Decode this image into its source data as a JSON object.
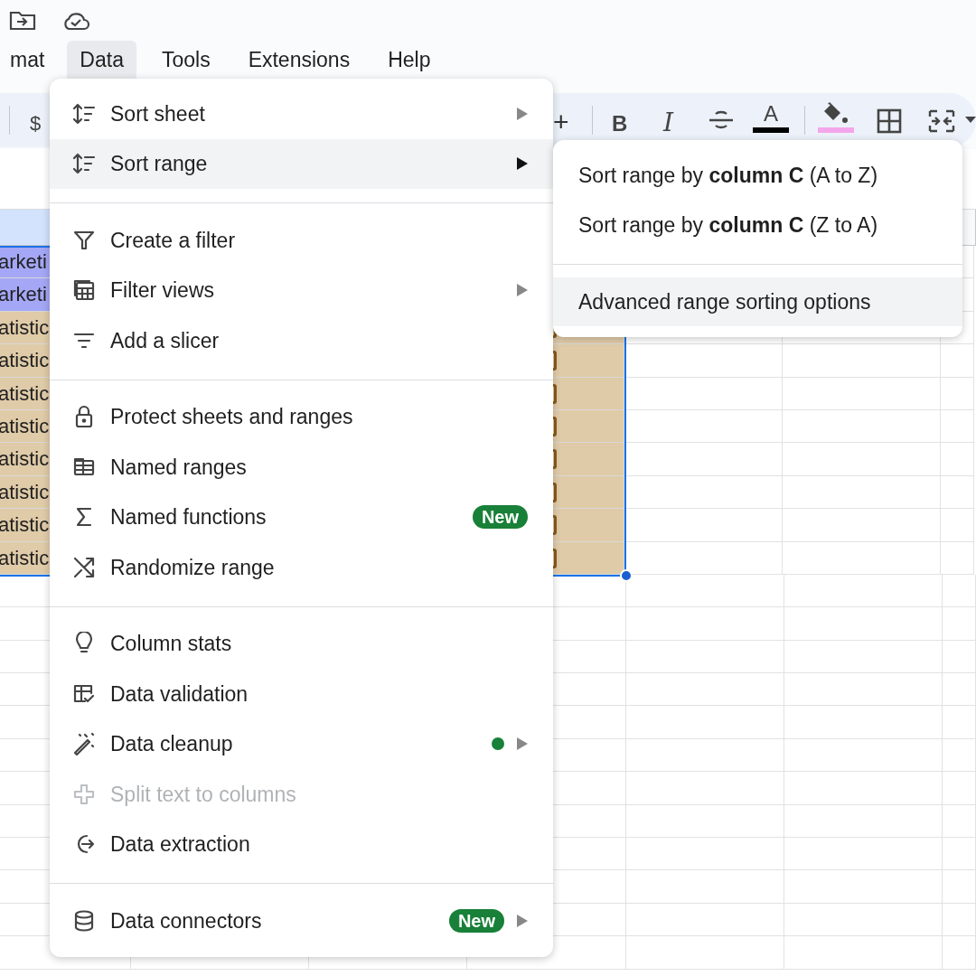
{
  "menu_bar": [
    {
      "label": "mat",
      "selected": false
    },
    {
      "label": "Data",
      "selected": true
    },
    {
      "label": "Tools",
      "selected": false
    },
    {
      "label": "Extensions",
      "selected": false
    },
    {
      "label": "Help",
      "selected": false
    }
  ],
  "toolbar": {
    "currency": "$",
    "plus": "+",
    "bold": "B",
    "italic": "I",
    "text_color": "A"
  },
  "sheet": {
    "rows": [
      {
        "text": "arketi",
        "color": "#a4a7f5"
      },
      {
        "text": "arketi",
        "color": "#a4a7f5"
      },
      {
        "text": "atistic",
        "color": "#e0cba8"
      },
      {
        "text": "atistic",
        "color": "#e0cba8"
      },
      {
        "text": "atistic",
        "color": "#e0cba8"
      },
      {
        "text": "atistic",
        "color": "#e0cba8"
      },
      {
        "text": "atistic",
        "color": "#e0cba8"
      },
      {
        "text": "atistic",
        "color": "#e0cba8"
      },
      {
        "text": "atistic",
        "color": "#e0cba8"
      },
      {
        "text": "atistic",
        "color": "#e0cba8"
      }
    ]
  },
  "data_menu": {
    "sections": [
      [
        {
          "label": "Sort sheet",
          "selected": false,
          "disabled": false,
          "submenu": true,
          "dot": false
        },
        {
          "label": "Sort range",
          "selected": true,
          "disabled": false,
          "submenu": true,
          "dot": false
        }
      ],
      [
        {
          "label": "Create a filter",
          "selected": false,
          "disabled": false,
          "submenu": false,
          "dot": false
        },
        {
          "label": "Filter views",
          "selected": false,
          "disabled": false,
          "submenu": true,
          "dot": false
        },
        {
          "label": "Add a slicer",
          "selected": false,
          "disabled": false,
          "submenu": false,
          "dot": false
        }
      ],
      [
        {
          "label": "Protect sheets and ranges",
          "selected": false,
          "disabled": false,
          "submenu": false,
          "dot": false
        },
        {
          "label": "Named ranges",
          "selected": false,
          "disabled": false,
          "submenu": false,
          "dot": false
        },
        {
          "label": "Named functions",
          "selected": false,
          "disabled": false,
          "submenu": false,
          "dot": false,
          "badge": "New"
        },
        {
          "label": "Randomize range",
          "selected": false,
          "disabled": false,
          "submenu": false,
          "dot": false
        }
      ],
      [
        {
          "label": "Column stats",
          "selected": false,
          "disabled": false,
          "submenu": false,
          "dot": false
        },
        {
          "label": "Data validation",
          "selected": false,
          "disabled": false,
          "submenu": false,
          "dot": false
        },
        {
          "label": "Data cleanup",
          "selected": false,
          "disabled": false,
          "submenu": true,
          "dot": true
        },
        {
          "label": "Split text to columns",
          "selected": false,
          "disabled": true,
          "submenu": false,
          "dot": false
        },
        {
          "label": "Data extraction",
          "selected": false,
          "disabled": false,
          "submenu": false,
          "dot": false
        }
      ],
      [
        {
          "label": "Data connectors",
          "selected": false,
          "disabled": false,
          "submenu": true,
          "dot": false,
          "badge": "New"
        }
      ]
    ]
  },
  "sort_range_submenu": {
    "sections": [
      [
        {
          "label": "Sort range by **column C** (A to Z)",
          "selected": false
        },
        {
          "label": "Sort range by **column C** (Z to A)",
          "selected": false
        }
      ],
      [
        {
          "label": "Advanced range sorting options",
          "selected": true
        }
      ]
    ]
  }
}
